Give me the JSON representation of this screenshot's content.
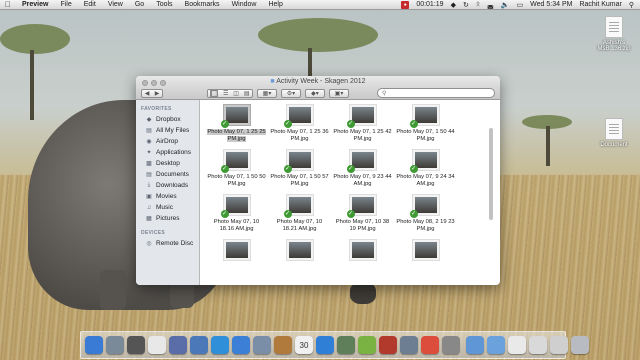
{
  "menubar": {
    "apple_icon": "apple-icon",
    "items": [
      "Preview",
      "File",
      "Edit",
      "View",
      "Go",
      "Tools",
      "Bookmarks",
      "Window",
      "Help"
    ],
    "recording_time": "00:01:19",
    "clock": "Wed 5:34 PM",
    "user": "Rachit Kumar"
  },
  "desktop_icons": [
    {
      "label": "Ashish's MsB...36.zip",
      "icon": "zip-file-icon"
    },
    {
      "label": "Document",
      "icon": "document-icon"
    }
  ],
  "window": {
    "title": "Activity Week - Skagen 2012",
    "search_placeholder": "",
    "sidebar": {
      "favorites_header": "FAVORITES",
      "favorites": [
        {
          "label": "Dropbox",
          "icon": "dropbox-icon"
        },
        {
          "label": "All My Files",
          "icon": "all-files-icon"
        },
        {
          "label": "AirDrop",
          "icon": "airdrop-icon"
        },
        {
          "label": "Applications",
          "icon": "applications-icon"
        },
        {
          "label": "Desktop",
          "icon": "desktop-icon"
        },
        {
          "label": "Documents",
          "icon": "documents-icon"
        },
        {
          "label": "Downloads",
          "icon": "downloads-icon"
        },
        {
          "label": "Movies",
          "icon": "movies-icon"
        },
        {
          "label": "Music",
          "icon": "music-icon"
        },
        {
          "label": "Pictures",
          "icon": "pictures-icon"
        }
      ],
      "devices_header": "DEVICES",
      "devices": [
        {
          "label": "Remote Disc",
          "icon": "remote-disc-icon"
        }
      ]
    },
    "files": [
      {
        "name": "Photo May 07, 1 25 25 PM.jpg",
        "selected": true
      },
      {
        "name": "Photo May 07, 1 25 36 PM.jpg",
        "selected": false
      },
      {
        "name": "Photo May 07, 1 25 42 PM.jpg",
        "selected": false
      },
      {
        "name": "Photo May 07, 1 50 44 PM.jpg",
        "selected": false
      },
      {
        "name": "Photo May 07, 1 50 50 PM.jpg",
        "selected": false
      },
      {
        "name": "Photo May 07, 1 50 57 PM.jpg",
        "selected": false
      },
      {
        "name": "Photo May 07, 9 23 44 AM.jpg",
        "selected": false
      },
      {
        "name": "Photo May 07, 9 24 34 AM.jpg",
        "selected": false
      },
      {
        "name": "Photo May 07, 10 18.16 AM.jpg",
        "selected": false
      },
      {
        "name": "Photo May 07, 10 18.21 AM.jpg",
        "selected": false
      },
      {
        "name": "Photo May 07, 10 38 19 PM.jpg",
        "selected": false
      },
      {
        "name": "Photo May 08, 2 19 23 PM.jpg",
        "selected": false
      },
      {
        "name": "",
        "selected": false
      },
      {
        "name": "",
        "selected": false
      },
      {
        "name": "",
        "selected": false
      },
      {
        "name": "",
        "selected": false
      }
    ]
  },
  "dock": [
    {
      "icon": "finder-icon",
      "color": "#3a7bd5"
    },
    {
      "icon": "launchpad-icon",
      "color": "#7b8a99"
    },
    {
      "icon": "system-icon",
      "color": "#555555"
    },
    {
      "icon": "wifi-tool-icon",
      "color": "#e8e8e8"
    },
    {
      "icon": "pen-tool-icon",
      "color": "#5a6da8"
    },
    {
      "icon": "xcode-icon",
      "color": "#4a78b8"
    },
    {
      "icon": "safari-icon",
      "color": "#2f8fd8"
    },
    {
      "icon": "app-store-icon",
      "color": "#3c7fd6"
    },
    {
      "icon": "mail-icon",
      "color": "#7a8ea8"
    },
    {
      "icon": "address-book-icon",
      "color": "#b07a3c"
    },
    {
      "icon": "calendar-icon",
      "color": "#f0f0f0"
    },
    {
      "icon": "itunes-icon",
      "color": "#2f7fd6"
    },
    {
      "icon": "preview-icon",
      "color": "#5e7f5a"
    },
    {
      "icon": "spotify-icon",
      "color": "#7ab341"
    },
    {
      "icon": "photo-booth-icon",
      "color": "#b23a2c"
    },
    {
      "icon": "iphoto-icon",
      "color": "#6d7d92"
    },
    {
      "icon": "chrome-icon",
      "color": "#dc4d3c"
    },
    {
      "icon": "settings-icon",
      "color": "#888888"
    },
    {
      "icon": "folder-icon",
      "color": "#5f96d6"
    },
    {
      "icon": "folder-icon",
      "color": "#6ba1dc"
    },
    {
      "icon": "document-stack-icon",
      "color": "#e9e9e9"
    },
    {
      "icon": "document-stack-icon",
      "color": "#d9d9d9"
    },
    {
      "icon": "document-stack-icon",
      "color": "#cfcfcf"
    },
    {
      "icon": "trash-icon",
      "color": "#b8bcc2"
    }
  ],
  "dock_labels": {
    "calendar_day": "30"
  }
}
